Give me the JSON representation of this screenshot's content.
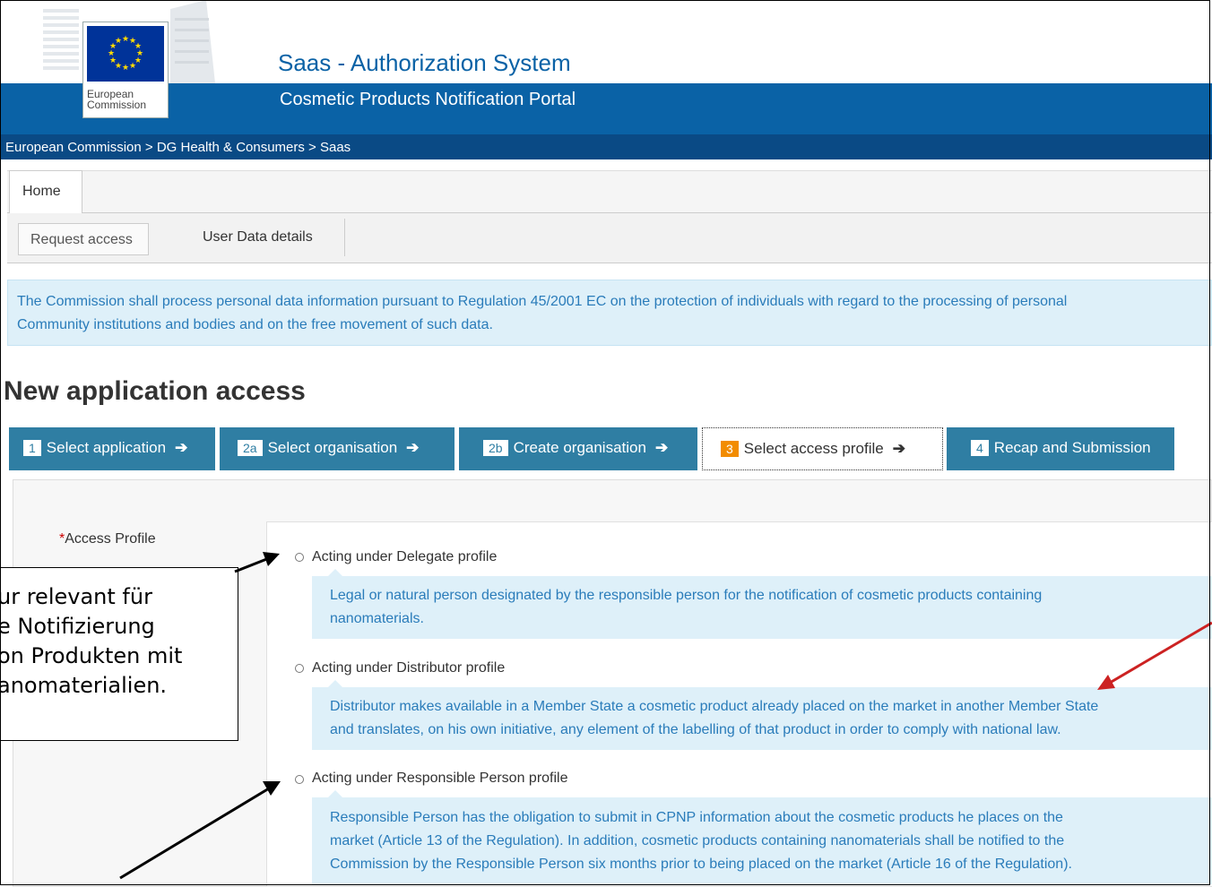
{
  "header": {
    "logo_text_line1": "European",
    "logo_text_line2": "Commission",
    "app_title": "Saas - Authorization System",
    "app_subtitle": "Cosmetic Products Notification Portal"
  },
  "breadcrumb": "European Commission > DG Health & Consumers > Saas",
  "tabs": {
    "main": [
      "Home"
    ],
    "sub": [
      "Request access",
      "User Data details"
    ]
  },
  "info": {
    "line1": "The Commission shall process personal data information pursuant to Regulation 45/2001 EC on the protection of individuals with regard to the processing of personal",
    "line2": "Community institutions and bodies and on the free movement of such data."
  },
  "page_title": "New application access",
  "steps": [
    {
      "num": "1",
      "label": "Select application"
    },
    {
      "num": "2a",
      "label": "Select organisation"
    },
    {
      "num": "2b",
      "label": "Create organisation"
    },
    {
      "num": "3",
      "label": "Select access profile",
      "active": true
    },
    {
      "num": "4",
      "label": "Recap and Submission"
    }
  ],
  "form": {
    "required_mark": "*",
    "access_profile_label": "Access Profile",
    "options": [
      {
        "label": "Acting under Delegate profile",
        "desc_lines": [
          "Legal or natural person designated by the responsible person for the notification of cosmetic products containing",
          "nanomaterials."
        ]
      },
      {
        "label": "Acting under Distributor profile",
        "desc_lines": [
          "Distributor makes available in a Member State a cosmetic product already placed on the market in another Member State",
          "and translates, on his own initiative, any element of the labelling of that product in order to comply with national law."
        ]
      },
      {
        "label": "Acting under Responsible Person profile",
        "desc_lines": [
          "Responsible Person has the obligation to submit in CPNP information about the cosmetic products he places on the",
          "market (Article 13 of the Regulation). In addition, cosmetic products containing nanomaterials shall be notified to the",
          "Commission by the Responsible Person six months prior to being placed on the market (Article 16 of the Regulation)."
        ]
      }
    ]
  },
  "annotation": {
    "lines": [
      "ur relevant für",
      "e Notifizierung",
      "on Produkten mit",
      "anomaterialien."
    ]
  },
  "colors": {
    "brand_blue": "#0a62a6",
    "step_blue": "#2f7ea3",
    "step_active_num": "#f28c00",
    "info_bg": "#def0f9",
    "info_text": "#2a7cba",
    "annotation_red_arrow": "#cc2222"
  }
}
